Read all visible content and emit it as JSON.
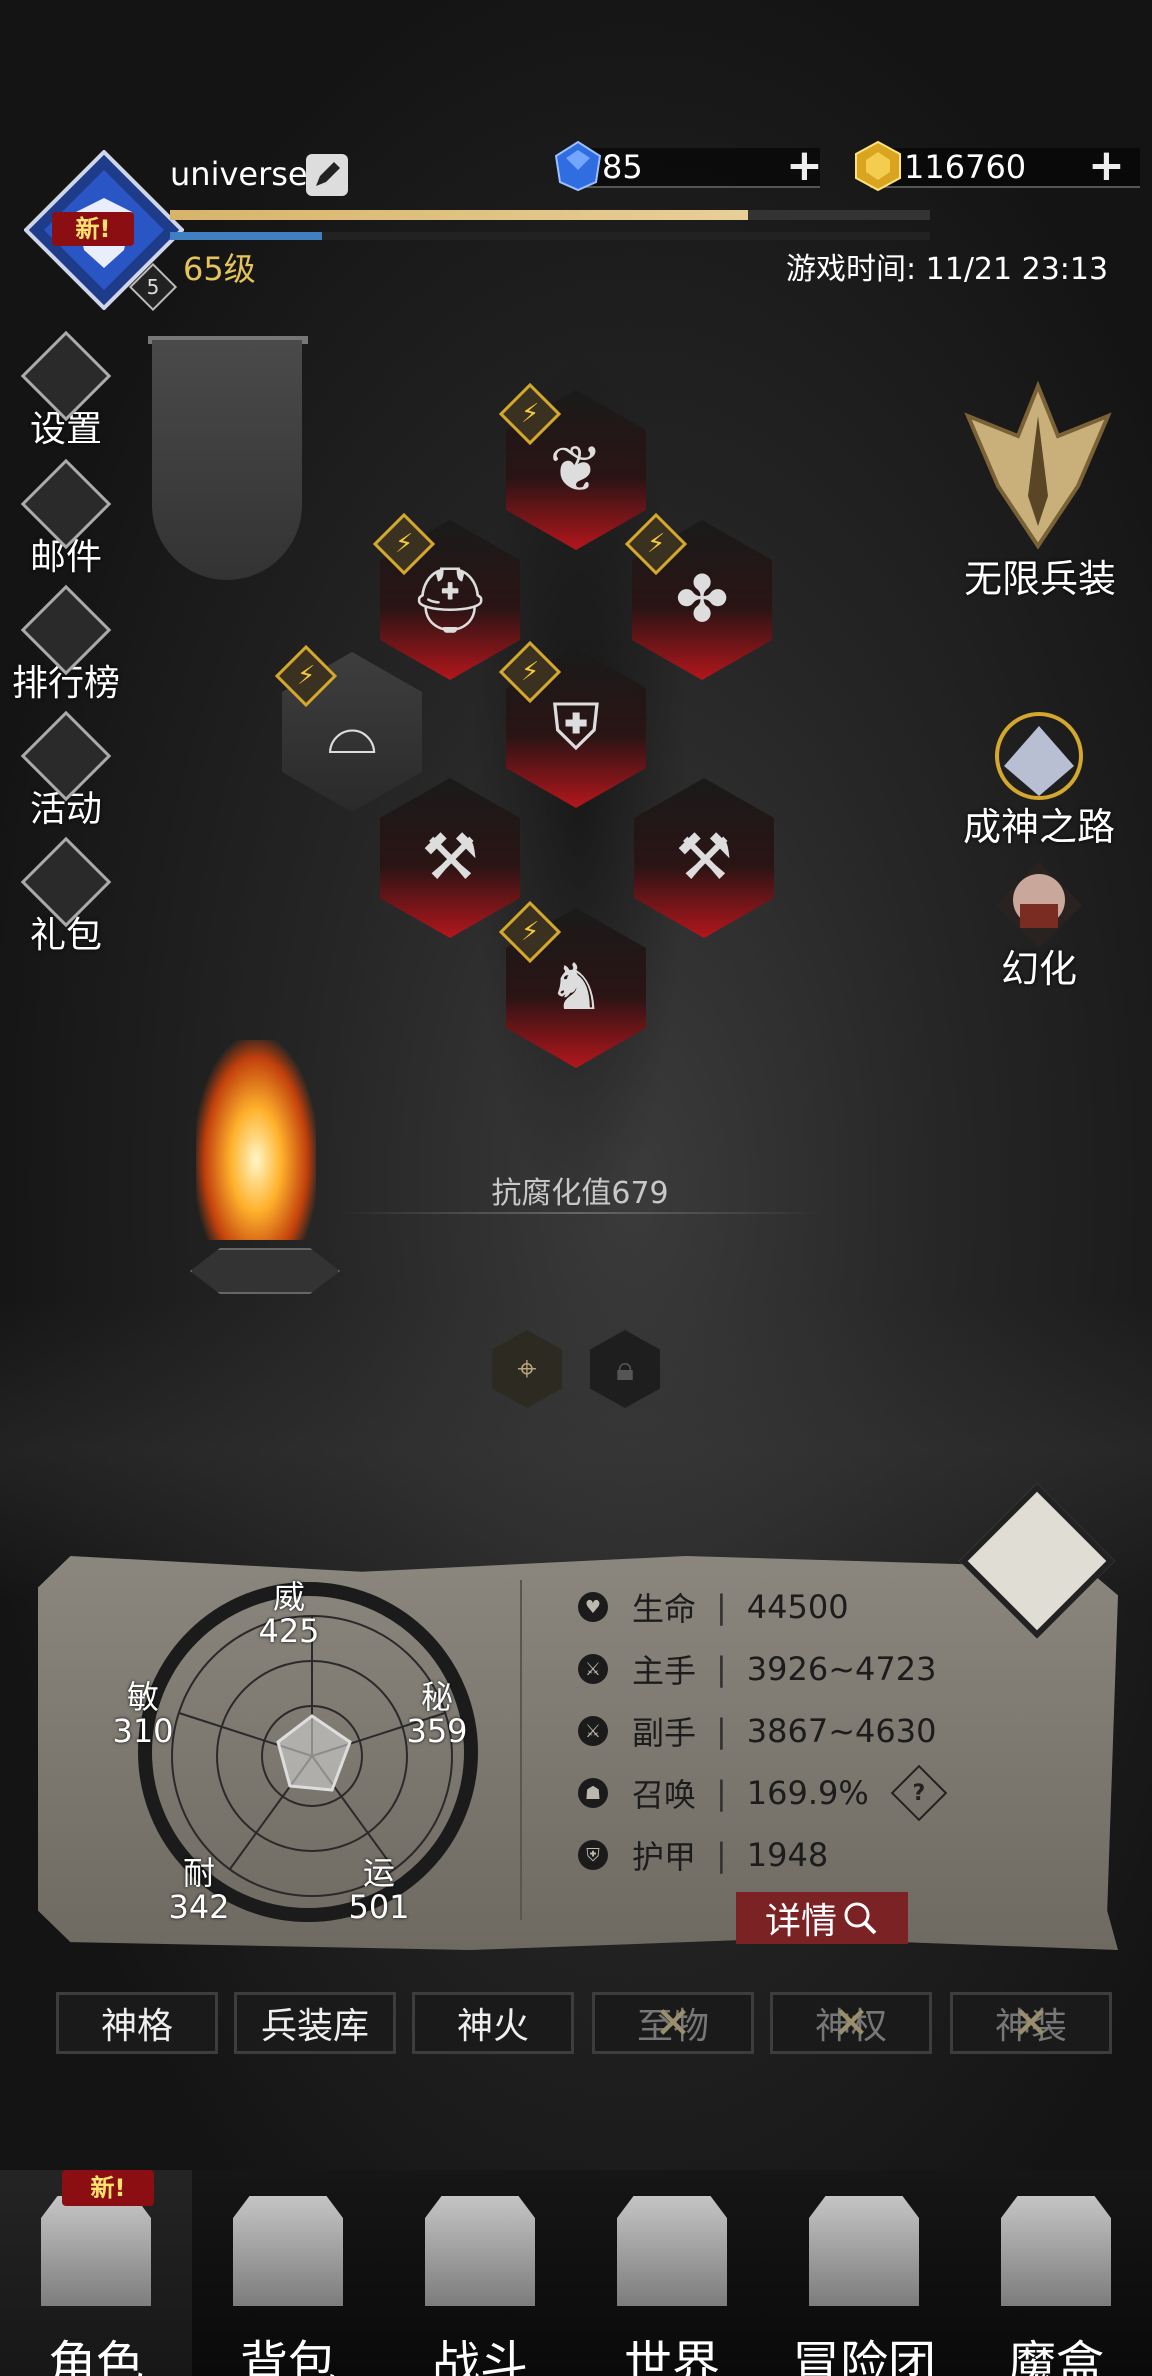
{
  "header": {
    "username": "universe",
    "new_badge": "新!",
    "level_badge": "5",
    "level": "65级",
    "game_time": "游戏时间: 11/21 23:13",
    "exp_progress": 0.76,
    "sub_progress": 0.2
  },
  "currency": {
    "gems": "85",
    "gold": "116760",
    "plus": "+"
  },
  "left_menu": [
    {
      "label": "设置",
      "icon": "gear-icon"
    },
    {
      "label": "邮件",
      "icon": "mail-icon"
    },
    {
      "label": "排行榜",
      "icon": "leaderboard-icon"
    },
    {
      "label": "活动",
      "icon": "activity-icon"
    },
    {
      "label": "礼包",
      "icon": "gift-icon"
    }
  ],
  "right_menu": {
    "infinite_gear": "无限兵装",
    "godhood_path": "成神之路",
    "transform": "幻化"
  },
  "equipment": {
    "bolt": "⚡",
    "slots": [
      "scarf",
      "helmet",
      "necklace",
      "armor",
      "belt",
      "weapon-left",
      "weapon-right",
      "boots"
    ]
  },
  "corrosion_resistance": "抗腐化值679",
  "attributes": {
    "wei": {
      "label": "威",
      "value": "425"
    },
    "mi": {
      "label": "秘",
      "value": "359"
    },
    "yun": {
      "label": "运",
      "value": "501"
    },
    "nai": {
      "label": "耐",
      "value": "342"
    },
    "min": {
      "label": "敏",
      "value": "310"
    }
  },
  "stats": [
    {
      "label": "生命",
      "value": "44500"
    },
    {
      "label": "主手",
      "value": "3926~4723"
    },
    {
      "label": "副手",
      "value": "3867~4630"
    },
    {
      "label": "召唤",
      "value": "169.9%"
    },
    {
      "label": "护甲",
      "value": "1948"
    }
  ],
  "stat_separator": "|",
  "help": "?",
  "details_button": "详情",
  "tabs": [
    {
      "label": "神格",
      "locked": false
    },
    {
      "label": "兵装库",
      "locked": false
    },
    {
      "label": "神火",
      "locked": false
    },
    {
      "label": "至物",
      "locked": true
    },
    {
      "label": "神权",
      "locked": true
    },
    {
      "label": "神装",
      "locked": true
    }
  ],
  "bottom_nav": [
    {
      "label": "角色",
      "active": true
    },
    {
      "label": "背包"
    },
    {
      "label": "战斗"
    },
    {
      "label": "世界"
    },
    {
      "label": "冒险团"
    },
    {
      "label": "魔盒"
    }
  ],
  "colors": {
    "accent_red": "#b3161c",
    "gold": "#e6c45a",
    "exp_blue": "#3f7fc2"
  }
}
